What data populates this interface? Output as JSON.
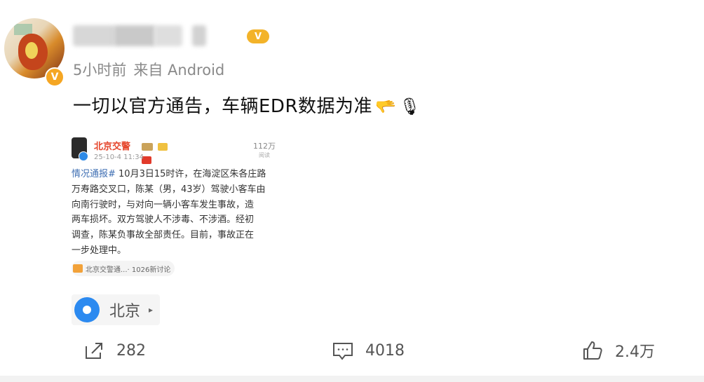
{
  "post": {
    "meta": {
      "time": "5小时前",
      "source": "来自 Android"
    },
    "text": "一切以官方通告，车辆EDR数据为准",
    "emojis": [
      "🫳",
      "🎙"
    ],
    "embedded": {
      "account": "北京交警",
      "date": "25-10-4 11:34",
      "views": "112万",
      "views_label": "阅读",
      "lines": [
        {
          "tag": "情况通报#",
          "text": " 10月3日15时许，在海淀区朱各庄路"
        },
        {
          "tag": "",
          "text": "万寿路交叉口，陈某（男，43岁）驾驶小客车由"
        },
        {
          "tag": "",
          "text": "向南行驶时，与对向一辆小客车发生事故，造"
        },
        {
          "tag": "",
          "text": "两车损坏。双方驾驶人不涉毒、不涉酒。经初"
        },
        {
          "tag": "",
          "text": "调查，陈某负事故全部责任。目前，事故正在"
        },
        {
          "tag": "",
          "text": "一步处理中。"
        }
      ],
      "footer_topic": "北京交警通...",
      "footer_count": "· 1026新讨论"
    },
    "location": {
      "label": "北京",
      "caret": "▸"
    },
    "actions": {
      "share_count": "282",
      "comment_count": "4018",
      "like_count": "2.4万"
    }
  },
  "icons": {
    "vip": "vip-badge-icon",
    "verified": "verified-v-icon",
    "location": "location-pin-icon",
    "share": "share-icon",
    "comment": "comment-icon",
    "like": "like-icon"
  },
  "colors": {
    "accent_blue": "#2c8af0",
    "vip_orange": "#f3b329",
    "embed_name": "#e5442a",
    "topic_link": "#3f6fb3"
  }
}
